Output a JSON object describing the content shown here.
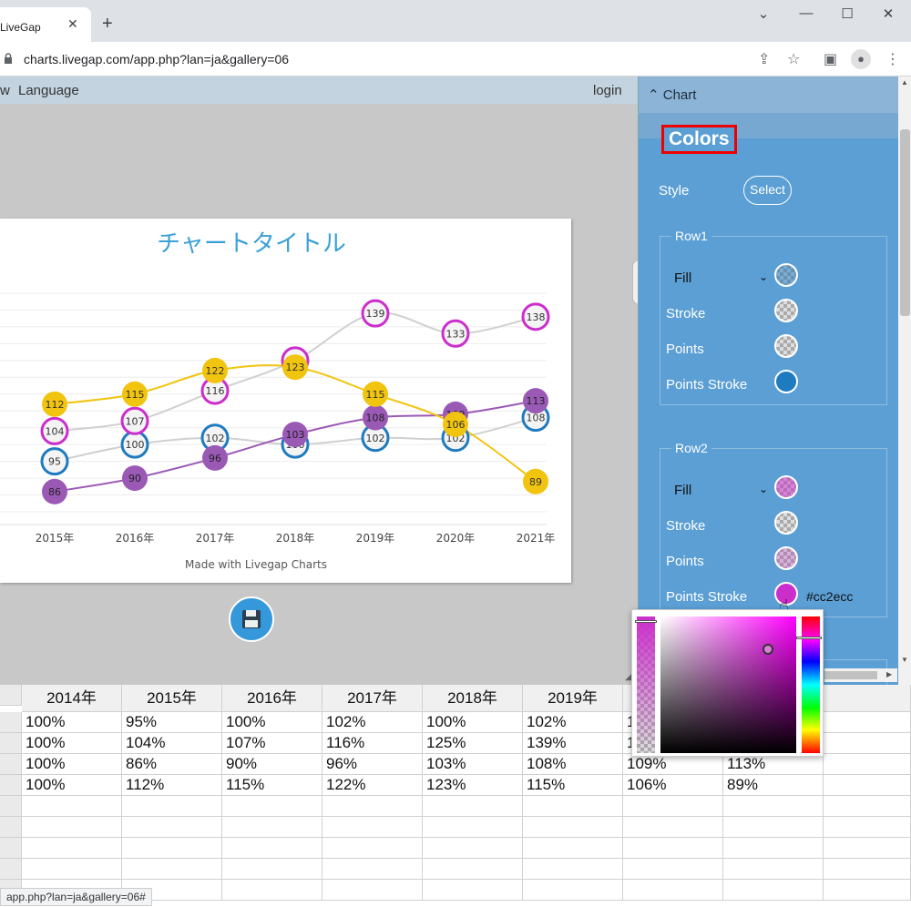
{
  "browser": {
    "tab_title": "LiveGap",
    "url": "charts.livegap.com/app.php?lan=ja&gallery=06",
    "status_url": "app.php?lan=ja&gallery=06#"
  },
  "app_nav": {
    "view": "w",
    "language": "Language",
    "login": "login"
  },
  "side_panel": {
    "section": "⌃ Chart",
    "colors_title": "Colors",
    "style_label": "Style",
    "select_button": "Select",
    "rows": [
      {
        "legend": "Row1",
        "fill": "Fill",
        "stroke": "Stroke",
        "points": "Points",
        "points_stroke": "Points Stroke"
      },
      {
        "legend": "Row2",
        "fill": "Fill",
        "stroke": "Stroke",
        "points": "Points",
        "points_stroke": "Points Stroke",
        "hex": "#cc2ecc"
      }
    ]
  },
  "colors": {
    "row1_points_stroke": "#1f7bbf",
    "row2_points_stroke": "#cc2ecc",
    "row3": "#9b59b6",
    "row4": "#f1c40f",
    "grey_line": "#d0d0d0",
    "title": "#3aa0d8"
  },
  "chart_data": {
    "type": "line",
    "title": "チャートタイトル",
    "credit": "Made with Livegap Charts",
    "categories": [
      "2015年",
      "2016年",
      "2017年",
      "2018年",
      "2019年",
      "2020年",
      "2021年"
    ],
    "series": [
      {
        "values": [
          95,
          100,
          102,
          100,
          102,
          102,
          108
        ],
        "color": "#1f7bbf",
        "style": "ring"
      },
      {
        "values": [
          104,
          107,
          116,
          125,
          139,
          133,
          138
        ],
        "color": "#cc2ecc",
        "style": "ring"
      },
      {
        "values": [
          86,
          90,
          96,
          103,
          108,
          109,
          113
        ],
        "color": "#9b59b6",
        "style": "dot"
      },
      {
        "values": [
          112,
          115,
          122,
          123,
          115,
          106,
          89
        ],
        "color": "#f1c40f",
        "style": "dot"
      }
    ],
    "ylim": [
      80,
      145
    ],
    "grid": true
  },
  "table": {
    "headers": [
      "2014年",
      "2015年",
      "2016年",
      "2017年",
      "2018年",
      "2019年",
      "",
      ""
    ],
    "rows": [
      [
        "100%",
        "95%",
        "100%",
        "102%",
        "100%",
        "102%",
        "1",
        ""
      ],
      [
        "100%",
        "104%",
        "107%",
        "116%",
        "125%",
        "139%",
        "1",
        ""
      ],
      [
        "100%",
        "86%",
        "90%",
        "96%",
        "103%",
        "108%",
        "109%",
        "113%"
      ],
      [
        "100%",
        "112%",
        "115%",
        "122%",
        "123%",
        "115%",
        "106%",
        "89%"
      ]
    ]
  }
}
